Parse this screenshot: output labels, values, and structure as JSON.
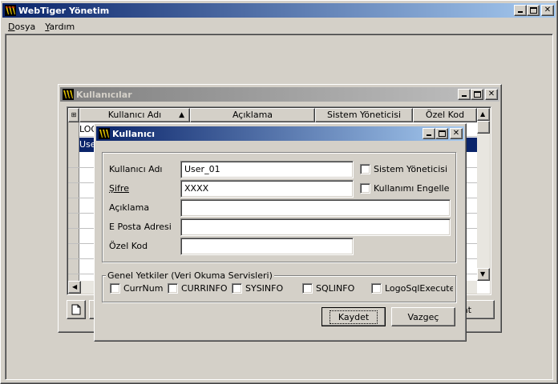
{
  "app": {
    "title": "WebTiger Yönetim",
    "menu": [
      "Dosya",
      "Yardım"
    ]
  },
  "users_window": {
    "title": "Kullanıcılar",
    "columns": [
      "Kullanıcı Adı",
      "Açıklama",
      "Sistem Yöneticisi",
      "Özel Kod"
    ],
    "rows": [
      "LOG",
      "Use"
    ],
    "right_button_partial": "at"
  },
  "user_dialog": {
    "title": "Kullanıcı",
    "username_label": "Kullanıcı Adı",
    "username_value": "User_01",
    "password_label": "Şifre",
    "password_value": "XXXX",
    "description_label": "Açıklama",
    "description_value": "",
    "email_label": "E Posta Adresi",
    "email_value": "",
    "special_code_label": "Özel Kod",
    "special_code_value": "",
    "sysadmin_label": "Sistem Yöneticisi",
    "disable_label": "Kullanımı Engelle",
    "permissions_group": "Genel Yetkiler (Veri Okuma Servisleri)",
    "permissions": [
      "CurrNum",
      "CURRINFO",
      "SYSINFO",
      "SQLINFO",
      "LogoSqlExecuter"
    ],
    "save_label": "Kaydet",
    "cancel_label": "Vazgeç"
  },
  "colors": {
    "title_active_start": "#0a246a",
    "title_active_end": "#a6caf0",
    "title_inactive_start": "#808080",
    "title_inactive_end": "#c0c0c0",
    "selection": "#0a246a",
    "face": "#d4d0c8"
  },
  "icons": [
    "app-icon",
    "minimize-icon",
    "maximize-icon",
    "close-icon",
    "sort-up-icon",
    "scroll-up-icon",
    "scroll-down-icon",
    "scroll-left-icon",
    "new-document-icon"
  ]
}
